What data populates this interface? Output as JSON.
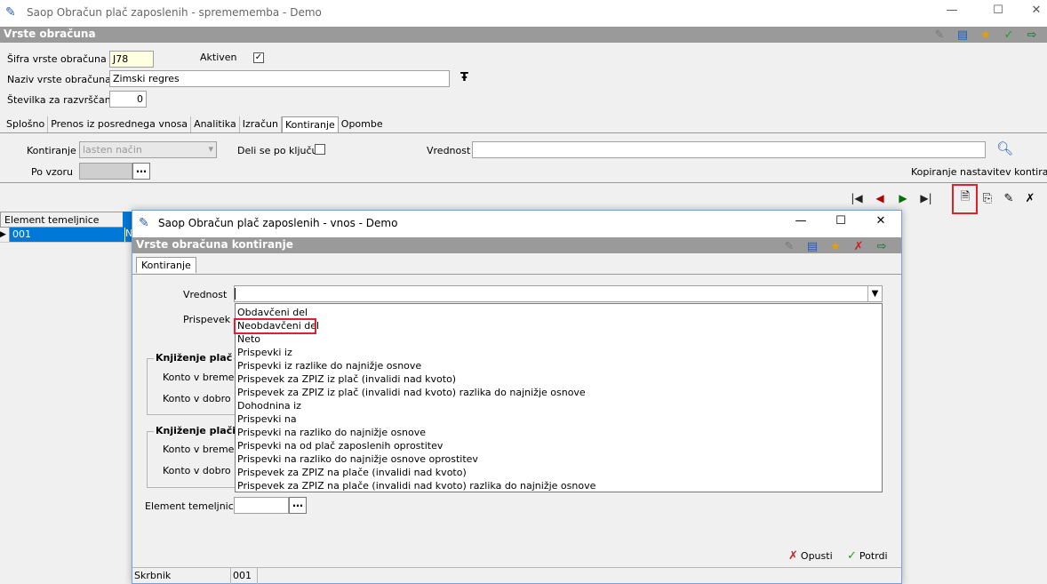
{
  "window": {
    "title": "Saop Obračun plač zaposlenih - spremememba - Demo"
  },
  "form_header": {
    "title": "Vrste obračuna"
  },
  "fields": {
    "sifra_label": "Šifra vrste obračuna",
    "sifra_value": "J78",
    "aktiven_label": "Aktiven",
    "aktiven_checked": "✓",
    "naziv_label": "Naziv vrste obračuna",
    "naziv_value": "Zimski regres",
    "naziv_icon": "Ŧ",
    "stevilka_label": "Številka  za razvrščanje",
    "stevilka_value": "0"
  },
  "tabs": [
    "Splošno",
    "Prenos iz posrednega vnosa",
    "Analitika",
    "Izračun",
    "Kontiranje",
    "Opombe"
  ],
  "kontiranje": {
    "kontiranje_label": "Kontiranje",
    "kontiranje_value": "lasten način",
    "deli_label": "Deli se po ključu",
    "vrednost_label": "Vrednost",
    "vrednost_value": "",
    "po_vzoru_label": "Po vzoru",
    "kopiranje_link": "Kopiranje nastavitev kontiranja"
  },
  "grid": {
    "column": "Element temeljnice",
    "row_value": "001",
    "row_extra": "Ne"
  },
  "dialog": {
    "title": "Saop Obračun plač zaposlenih - vnos - Demo",
    "header": "Vrste obračuna kontiranje",
    "tab": "Kontiranje",
    "vrednost_label": "Vrednost",
    "vrednost_value": "",
    "prispevek_label": "Prispevek",
    "knjizenje_plac_label": "Knjiženje plač",
    "konto_breme_label": "Konto v breme",
    "konto_dobro_label": "Konto v dobro",
    "knjizenje_placil_label": "Knjiženje plačil",
    "konto_breme2_label": "Konto v breme",
    "konto_dobro2_label": "Konto v dobro",
    "element_label": "Element temeljnice",
    "element_value": "",
    "options": [
      "Obdavčeni del",
      "Neobdavčeni del",
      "Neto",
      "Prispevki iz",
      "Prispevki iz razlike do najnižje osnove",
      "Prispevek za ZPIZ iz plač (invalidi nad kvoto)",
      "Prispevek za ZPIZ iz plač (invalidi nad kvoto) razlika do najnižje osnove",
      "Dohodnina iz",
      "Prispevki na",
      "Prispevki na razliko do najnižje osnove",
      "Prispevki na od plač zaposlenih oprostitev",
      "Prispevki na razliko do najnižje osnove oprostitev",
      "Prispevek za ZPIZ na plače (invalidi nad kvoto)",
      "Prispevek za ZPIZ na plače (invalidi nad kvoto) razlika do najnižje osnove"
    ],
    "cancel_button": "Opusti",
    "confirm_button": "Potrdi",
    "status_owner": "Skrbnik",
    "status_value": "001"
  },
  "colors": {
    "accent_red": "#e0202a",
    "header_gray": "#9a9a9a"
  }
}
